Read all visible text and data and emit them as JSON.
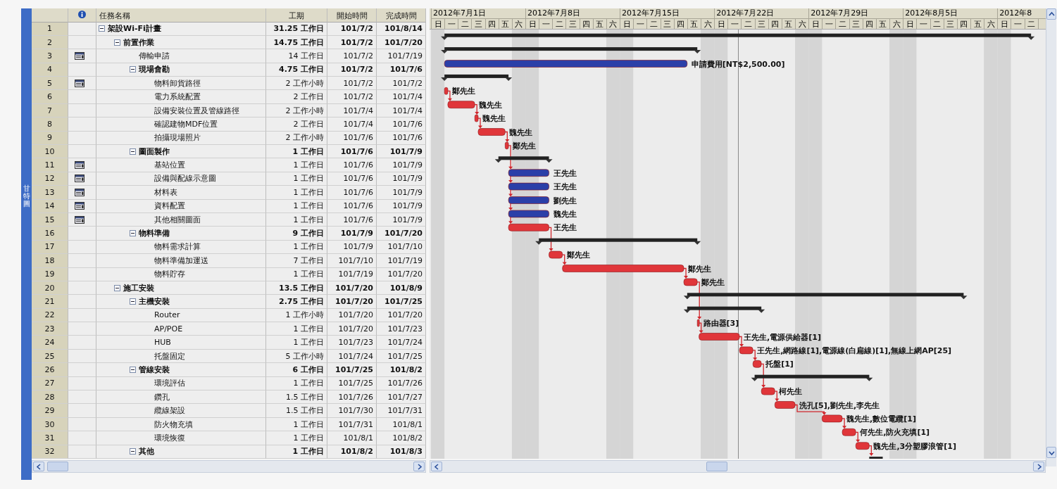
{
  "side_tab": {
    "label": "甘特圖"
  },
  "columns": [
    "任務名稱",
    "工期",
    "開始時間",
    "完成時間"
  ],
  "timescale": [
    {
      "label": "2012年7月1日",
      "days": [
        "日",
        "一",
        "二",
        "三",
        "四",
        "五",
        "六"
      ]
    },
    {
      "label": "2012年7月8日",
      "days": [
        "日",
        "一",
        "二",
        "三",
        "四",
        "五",
        "六"
      ]
    },
    {
      "label": "2012年7月15日",
      "days": [
        "日",
        "一",
        "二",
        "三",
        "四",
        "五",
        "六"
      ]
    },
    {
      "label": "2012年7月22日",
      "days": [
        "日",
        "一",
        "二",
        "三",
        "四",
        "五",
        "六"
      ]
    },
    {
      "label": "2012年7月29日",
      "days": [
        "日",
        "一",
        "二",
        "三",
        "四",
        "五",
        "六"
      ]
    },
    {
      "label": "2012年8月5日",
      "days": [
        "日",
        "一",
        "二",
        "三",
        "四",
        "五",
        "六"
      ]
    },
    {
      "label": "2012年8",
      "days": [
        "日",
        "一",
        "二"
      ]
    }
  ],
  "tasks": [
    {
      "id": "1",
      "name": "架設Wi-Fi計畫",
      "duration": "31.25 工作日",
      "start": "101/7/2",
      "finish": "101/8/14",
      "note": false,
      "expanded": true,
      "bar": {
        "kind": "summary"
      },
      "children": [
        {
          "id": "2",
          "name": "前置作業",
          "duration": "14.75 工作日",
          "start": "101/7/2",
          "finish": "101/7/20",
          "note": false,
          "expanded": true,
          "bar": {
            "kind": "summary"
          },
          "children": [
            {
              "id": "3",
              "name": "傳輸申請",
              "duration": "14 工作日",
              "start": "101/7/2",
              "finish": "101/7/19",
              "note": true,
              "bar": {
                "kind": "task_days",
                "color": "#2b3fa8",
                "label": "申請費用[NT$2,500.00]"
              }
            },
            {
              "id": "4",
              "name": "現場會勘",
              "duration": "4.75 工作日",
              "start": "101/7/2",
              "finish": "101/7/6",
              "note": false,
              "expanded": true,
              "bar": {
                "kind": "summary"
              },
              "children": [
                {
                  "id": "5",
                  "name": "物料卸貨路徑",
                  "duration": "2 工作小時",
                  "start": "101/7/2",
                  "finish": "101/7/2",
                  "note": true,
                  "bar": {
                    "kind": "task_hours",
                    "color": "#e0363a",
                    "label": "鄭先生"
                  }
                },
                {
                  "id": "6",
                  "name": "電力系統配置",
                  "duration": "2 工作日",
                  "start": "101/7/2",
                  "finish": "101/7/4",
                  "note": false,
                  "bar": {
                    "kind": "task_days",
                    "color": "#e0363a",
                    "label": "魏先生",
                    "linked": true,
                    "parallel": false
                  }
                },
                {
                  "id": "7",
                  "name": "設備安裝位置及管線路徑",
                  "duration": "2 工作小時",
                  "start": "101/7/4",
                  "finish": "101/7/4",
                  "note": false,
                  "bar": {
                    "kind": "task_hours",
                    "color": "#e0363a",
                    "label": "魏先生",
                    "linked": true,
                    "parallel": false
                  }
                },
                {
                  "id": "8",
                  "name": "確認建物MDF位置",
                  "duration": "2 工作日",
                  "start": "101/7/4",
                  "finish": "101/7/6",
                  "note": false,
                  "bar": {
                    "kind": "task_days",
                    "color": "#e0363a",
                    "label": "魏先生",
                    "linked": true,
                    "parallel": false
                  }
                },
                {
                  "id": "9",
                  "name": "拍攝現場照片",
                  "duration": "2 工作小時",
                  "start": "101/7/6",
                  "finish": "101/7/6",
                  "note": false,
                  "bar": {
                    "kind": "task_hours",
                    "color": "#e0363a",
                    "label": "鄭先生",
                    "linked": true,
                    "parallel": false
                  }
                }
              ]
            },
            {
              "id": "10",
              "name": "圖面製作",
              "duration": "1 工作日",
              "start": "101/7/6",
              "finish": "101/7/9",
              "note": false,
              "expanded": true,
              "bar": {
                "kind": "summary"
              },
              "children": [
                {
                  "id": "11",
                  "name": "基站位置",
                  "duration": "1 工作日",
                  "start": "101/7/6",
                  "finish": "101/7/9",
                  "note": true,
                  "bar": {
                    "kind": "task_days",
                    "color": "#2b3fa8",
                    "label": "王先生",
                    "linked": true,
                    "parallel": false
                  }
                },
                {
                  "id": "12",
                  "name": "設備與配線示意圖",
                  "duration": "1 工作日",
                  "start": "101/7/6",
                  "finish": "101/7/9",
                  "note": true,
                  "bar": {
                    "kind": "task_days",
                    "color": "#2b3fa8",
                    "label": "王先生",
                    "linked": true,
                    "parallel": true
                  }
                },
                {
                  "id": "13",
                  "name": "材料表",
                  "duration": "1 工作日",
                  "start": "101/7/6",
                  "finish": "101/7/9",
                  "note": true,
                  "bar": {
                    "kind": "task_days",
                    "color": "#2b3fa8",
                    "label": "劉先生",
                    "linked": true,
                    "parallel": true
                  }
                },
                {
                  "id": "14",
                  "name": "資料配置",
                  "duration": "1 工作日",
                  "start": "101/7/6",
                  "finish": "101/7/9",
                  "note": true,
                  "bar": {
                    "kind": "task_days",
                    "color": "#2b3fa8",
                    "label": "魏先生",
                    "linked": true,
                    "parallel": true
                  }
                },
                {
                  "id": "15",
                  "name": "其他相關圖面",
                  "duration": "1 工作日",
                  "start": "101/7/6",
                  "finish": "101/7/9",
                  "note": true,
                  "bar": {
                    "kind": "task_days",
                    "color": "#e0363a",
                    "label": "王先生",
                    "linked": true,
                    "parallel": true
                  }
                }
              ]
            },
            {
              "id": "16",
              "name": "物料準備",
              "duration": "9 工作日",
              "start": "101/7/9",
              "finish": "101/7/20",
              "note": false,
              "expanded": true,
              "bar": {
                "kind": "summary"
              },
              "children": [
                {
                  "id": "17",
                  "name": "物料需求計算",
                  "duration": "1 工作日",
                  "start": "101/7/9",
                  "finish": "101/7/10",
                  "note": false,
                  "bar": {
                    "kind": "task_days",
                    "color": "#e0363a",
                    "label": "鄭先生",
                    "linked": true,
                    "parallel": false
                  }
                },
                {
                  "id": "18",
                  "name": "物料準備加運送",
                  "duration": "7 工作日",
                  "start": "101/7/10",
                  "finish": "101/7/19",
                  "note": false,
                  "bar": {
                    "kind": "task_days",
                    "color": "#e0363a",
                    "label": "鄭先生",
                    "linked": true,
                    "parallel": false
                  }
                },
                {
                  "id": "19",
                  "name": "物料貯存",
                  "duration": "1 工作日",
                  "start": "101/7/19",
                  "finish": "101/7/20",
                  "note": false,
                  "bar": {
                    "kind": "task_days",
                    "color": "#e0363a",
                    "label": "鄭先生",
                    "linked": true,
                    "parallel": false
                  }
                }
              ]
            }
          ]
        },
        {
          "id": "20",
          "name": "施工安裝",
          "duration": "13.5 工作日",
          "start": "101/7/20",
          "finish": "101/8/9",
          "note": false,
          "expanded": true,
          "bar": {
            "kind": "summary"
          },
          "children": [
            {
              "id": "21",
              "name": "主機安裝",
              "duration": "2.75 工作日",
              "start": "101/7/20",
              "finish": "101/7/25",
              "note": false,
              "expanded": true,
              "bar": {
                "kind": "summary"
              },
              "children": [
                {
                  "id": "22",
                  "name": "Router",
                  "duration": "1 工作小時",
                  "start": "101/7/20",
                  "finish": "101/7/20",
                  "note": false,
                  "bar": {
                    "kind": "task_hours",
                    "color": "#e0363a",
                    "label": "路由器[3]",
                    "linked": true,
                    "parallel": false
                  }
                },
                {
                  "id": "23",
                  "name": "AP/POE",
                  "duration": "1 工作日",
                  "start": "101/7/20",
                  "finish": "101/7/23",
                  "note": false,
                  "bar": {
                    "kind": "task_days",
                    "color": "#e0363a",
                    "label": "王先生,電源供給器[1]",
                    "linked": true,
                    "parallel": false
                  }
                },
                {
                  "id": "24",
                  "name": "HUB",
                  "duration": "1 工作日",
                  "start": "101/7/23",
                  "finish": "101/7/24",
                  "note": false,
                  "bar": {
                    "kind": "task_days",
                    "color": "#e0363a",
                    "label": "王先生,網路線[1],電源線(白扁線)[1],無線上網AP[25]",
                    "linked": true,
                    "parallel": false
                  }
                },
                {
                  "id": "25",
                  "name": "托盤固定",
                  "duration": "5 工作小時",
                  "start": "101/7/24",
                  "finish": "101/7/25",
                  "note": false,
                  "bar": {
                    "kind": "task_hours",
                    "color": "#e0363a",
                    "label": "托盤[1]",
                    "linked": true,
                    "parallel": false
                  }
                }
              ]
            },
            {
              "id": "26",
              "name": "管線安裝",
              "duration": "6 工作日",
              "start": "101/7/25",
              "finish": "101/8/2",
              "note": false,
              "expanded": true,
              "bar": {
                "kind": "summary"
              },
              "children": [
                {
                  "id": "27",
                  "name": "環境評估",
                  "duration": "1 工作日",
                  "start": "101/7/25",
                  "finish": "101/7/26",
                  "note": false,
                  "bar": {
                    "kind": "task_days",
                    "color": "#e0363a",
                    "label": "柯先生",
                    "linked": true,
                    "parallel": false
                  }
                },
                {
                  "id": "28",
                  "name": "鑽孔",
                  "duration": "1.5 工作日",
                  "start": "101/7/26",
                  "finish": "101/7/27",
                  "note": false,
                  "bar": {
                    "kind": "task_days",
                    "color": "#e0363a",
                    "label": "洗孔[5],劉先生,李先生",
                    "linked": true,
                    "parallel": false
                  }
                },
                {
                  "id": "29",
                  "name": "纜線架設",
                  "duration": "1.5 工作日",
                  "start": "101/7/30",
                  "finish": "101/7/31",
                  "note": false,
                  "bar": {
                    "kind": "task_days",
                    "color": "#e0363a",
                    "label": "魏先生,數位電纜[1]",
                    "linked": true,
                    "parallel": false
                  }
                },
                {
                  "id": "30",
                  "name": "防火物充填",
                  "duration": "1 工作日",
                  "start": "101/7/31",
                  "finish": "101/8/1",
                  "note": false,
                  "bar": {
                    "kind": "task_days",
                    "color": "#e0363a",
                    "label": "何先生,防火充填[1]",
                    "linked": true,
                    "parallel": false
                  }
                },
                {
                  "id": "31",
                  "name": "環境恢復",
                  "duration": "1 工作日",
                  "start": "101/8/1",
                  "finish": "101/8/2",
                  "note": false,
                  "bar": {
                    "kind": "task_days",
                    "color": "#e0363a",
                    "label": "魏先生,3分塑膠浪管[1]",
                    "linked": true,
                    "parallel": false
                  }
                }
              ]
            },
            {
              "id": "32",
              "name": "其他",
              "duration": "1 工作日",
              "start": "101/8/2",
              "finish": "101/8/3",
              "note": false,
              "expanded": true,
              "bar": {
                "kind": "summary",
                "linked": true,
                "parallel": false
              }
            }
          ]
        }
      ]
    }
  ]
}
